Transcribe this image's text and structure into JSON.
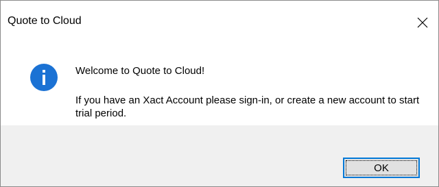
{
  "window": {
    "title": "Quote to Cloud"
  },
  "message": {
    "line1": "Welcome to Quote to Cloud!",
    "line2": "If you have an Xact Account please sign-in, or create a new account to start trial period."
  },
  "buttons": {
    "ok_label": "OK"
  },
  "icons": {
    "info": "info-icon",
    "close": "close-icon"
  },
  "colors": {
    "info_blue": "#1b72d4",
    "focus_border": "#0078d7",
    "footer_bg": "#f0f0f0"
  }
}
